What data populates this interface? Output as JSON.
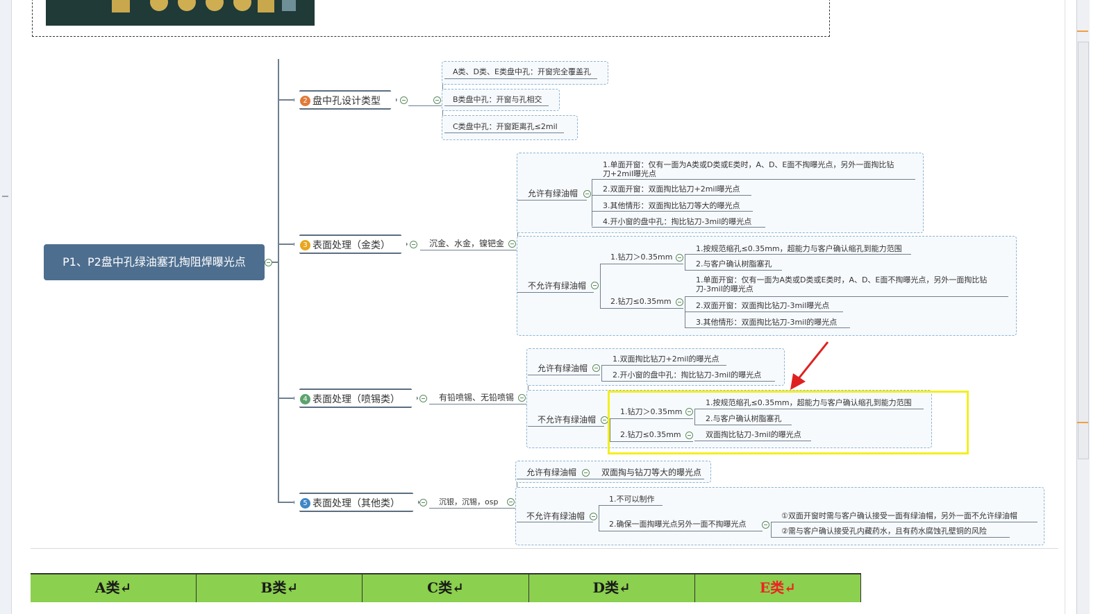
{
  "root": {
    "title": "P1、P2盘中孔绿油塞孔掏阻焊曝光点"
  },
  "branches": [
    {
      "num": "2",
      "label": "盘中孔设计类型",
      "color": "#e07b39"
    },
    {
      "num": "3",
      "label": "表面处理（金类）",
      "color": "#e8a71c"
    },
    {
      "num": "4",
      "label": "表面处理（喷锡类）",
      "color": "#5aa36d"
    },
    {
      "num": "5",
      "label": "表面处理（其他类）",
      "color": "#3f87c6"
    }
  ],
  "design_types": [
    "A类、D类、E类盘中孔：开窗完全覆盖孔",
    "B类盘中孔：开窗与孔相交",
    "C类盘中孔：开窗距离孔≤2mil"
  ],
  "gold": {
    "sub": "沉金、水金，镍钯金",
    "allow_label": "允许有绿油帽",
    "allow_items": [
      "1.单面开窗：仅有一面为A类或D类或E类时，A、D、E面不掏曝光点，另外一面掏比钻",
      "刀+2mil曝光点",
      "2.双面开窗：双面掏比钻刀+2mil曝光点",
      "3.其他情形：双面掏比钻刀等大的曝光点",
      "4.开小窗的盘中孔：掏比钻刀-3mil的曝光点"
    ],
    "deny_label": "不允许有绿油帽",
    "drill_gt": "1.钻刀＞0.35mm",
    "drill_gt_items": [
      "1.按规范缩孔≤0.35mm，超能力与客户确认缩孔到能力范围",
      "2.与客户确认树脂塞孔"
    ],
    "drill_le": "2.钻刀≤0.35mm",
    "drill_le_items": [
      "1.单面开窗：仅有一面为A类或D类或E类时，A、D、E面不掏曝光点，另外一面掏比钻",
      "刀-3mil的曝光点",
      "2.双面开窗：双面掏比钻刀-3mil曝光点",
      "3.其他情形：双面掏比钻刀-3mil的曝光点"
    ]
  },
  "tin": {
    "sub": "有铅喷锡、无铅喷锡",
    "allow_label": "允许有绿油帽",
    "allow_items": [
      "1.双面掏比钻刀+2mil的曝光点",
      "2.开小窗的盘中孔：掏比钻刀-3mil的曝光点"
    ],
    "deny_label": "不允许有绿油帽",
    "drill_gt": "1.钻刀＞0.35mm",
    "drill_gt_items": [
      "1.按规范缩孔≤0.35mm，超能力与客户确认缩孔到能力范围",
      "2.与客户确认树脂塞孔"
    ],
    "drill_le": "2.钻刀≤0.35mm",
    "drill_le_item": "双面掏比钻刀-3mil的曝光点"
  },
  "other": {
    "sub": "沉银，沉锡，osp",
    "allow_label": "允许有绿油帽",
    "allow_item": "双面掏与钻刀等大的曝光点",
    "deny_label": "不允许有绿油帽",
    "deny_items": [
      "1.不可以制作",
      "2.确保一面掏曝光点另外一面不掏曝光点"
    ],
    "notes": [
      "①双面开窗时需与客户确认接受一面有绿油帽，另外一面不允许绿油帽",
      "②需与客户确认接受孔内藏药水，且有药水腐蚀孔壁铜的风险"
    ]
  },
  "table_header": [
    "A类↵",
    "B类↵",
    "C类↵",
    "D类↵",
    "E类↵"
  ],
  "colors": {
    "root": "#4d6e8f",
    "highlight": "#f2ef1f",
    "arrow": "#e02020",
    "table": "#8bd04e"
  }
}
